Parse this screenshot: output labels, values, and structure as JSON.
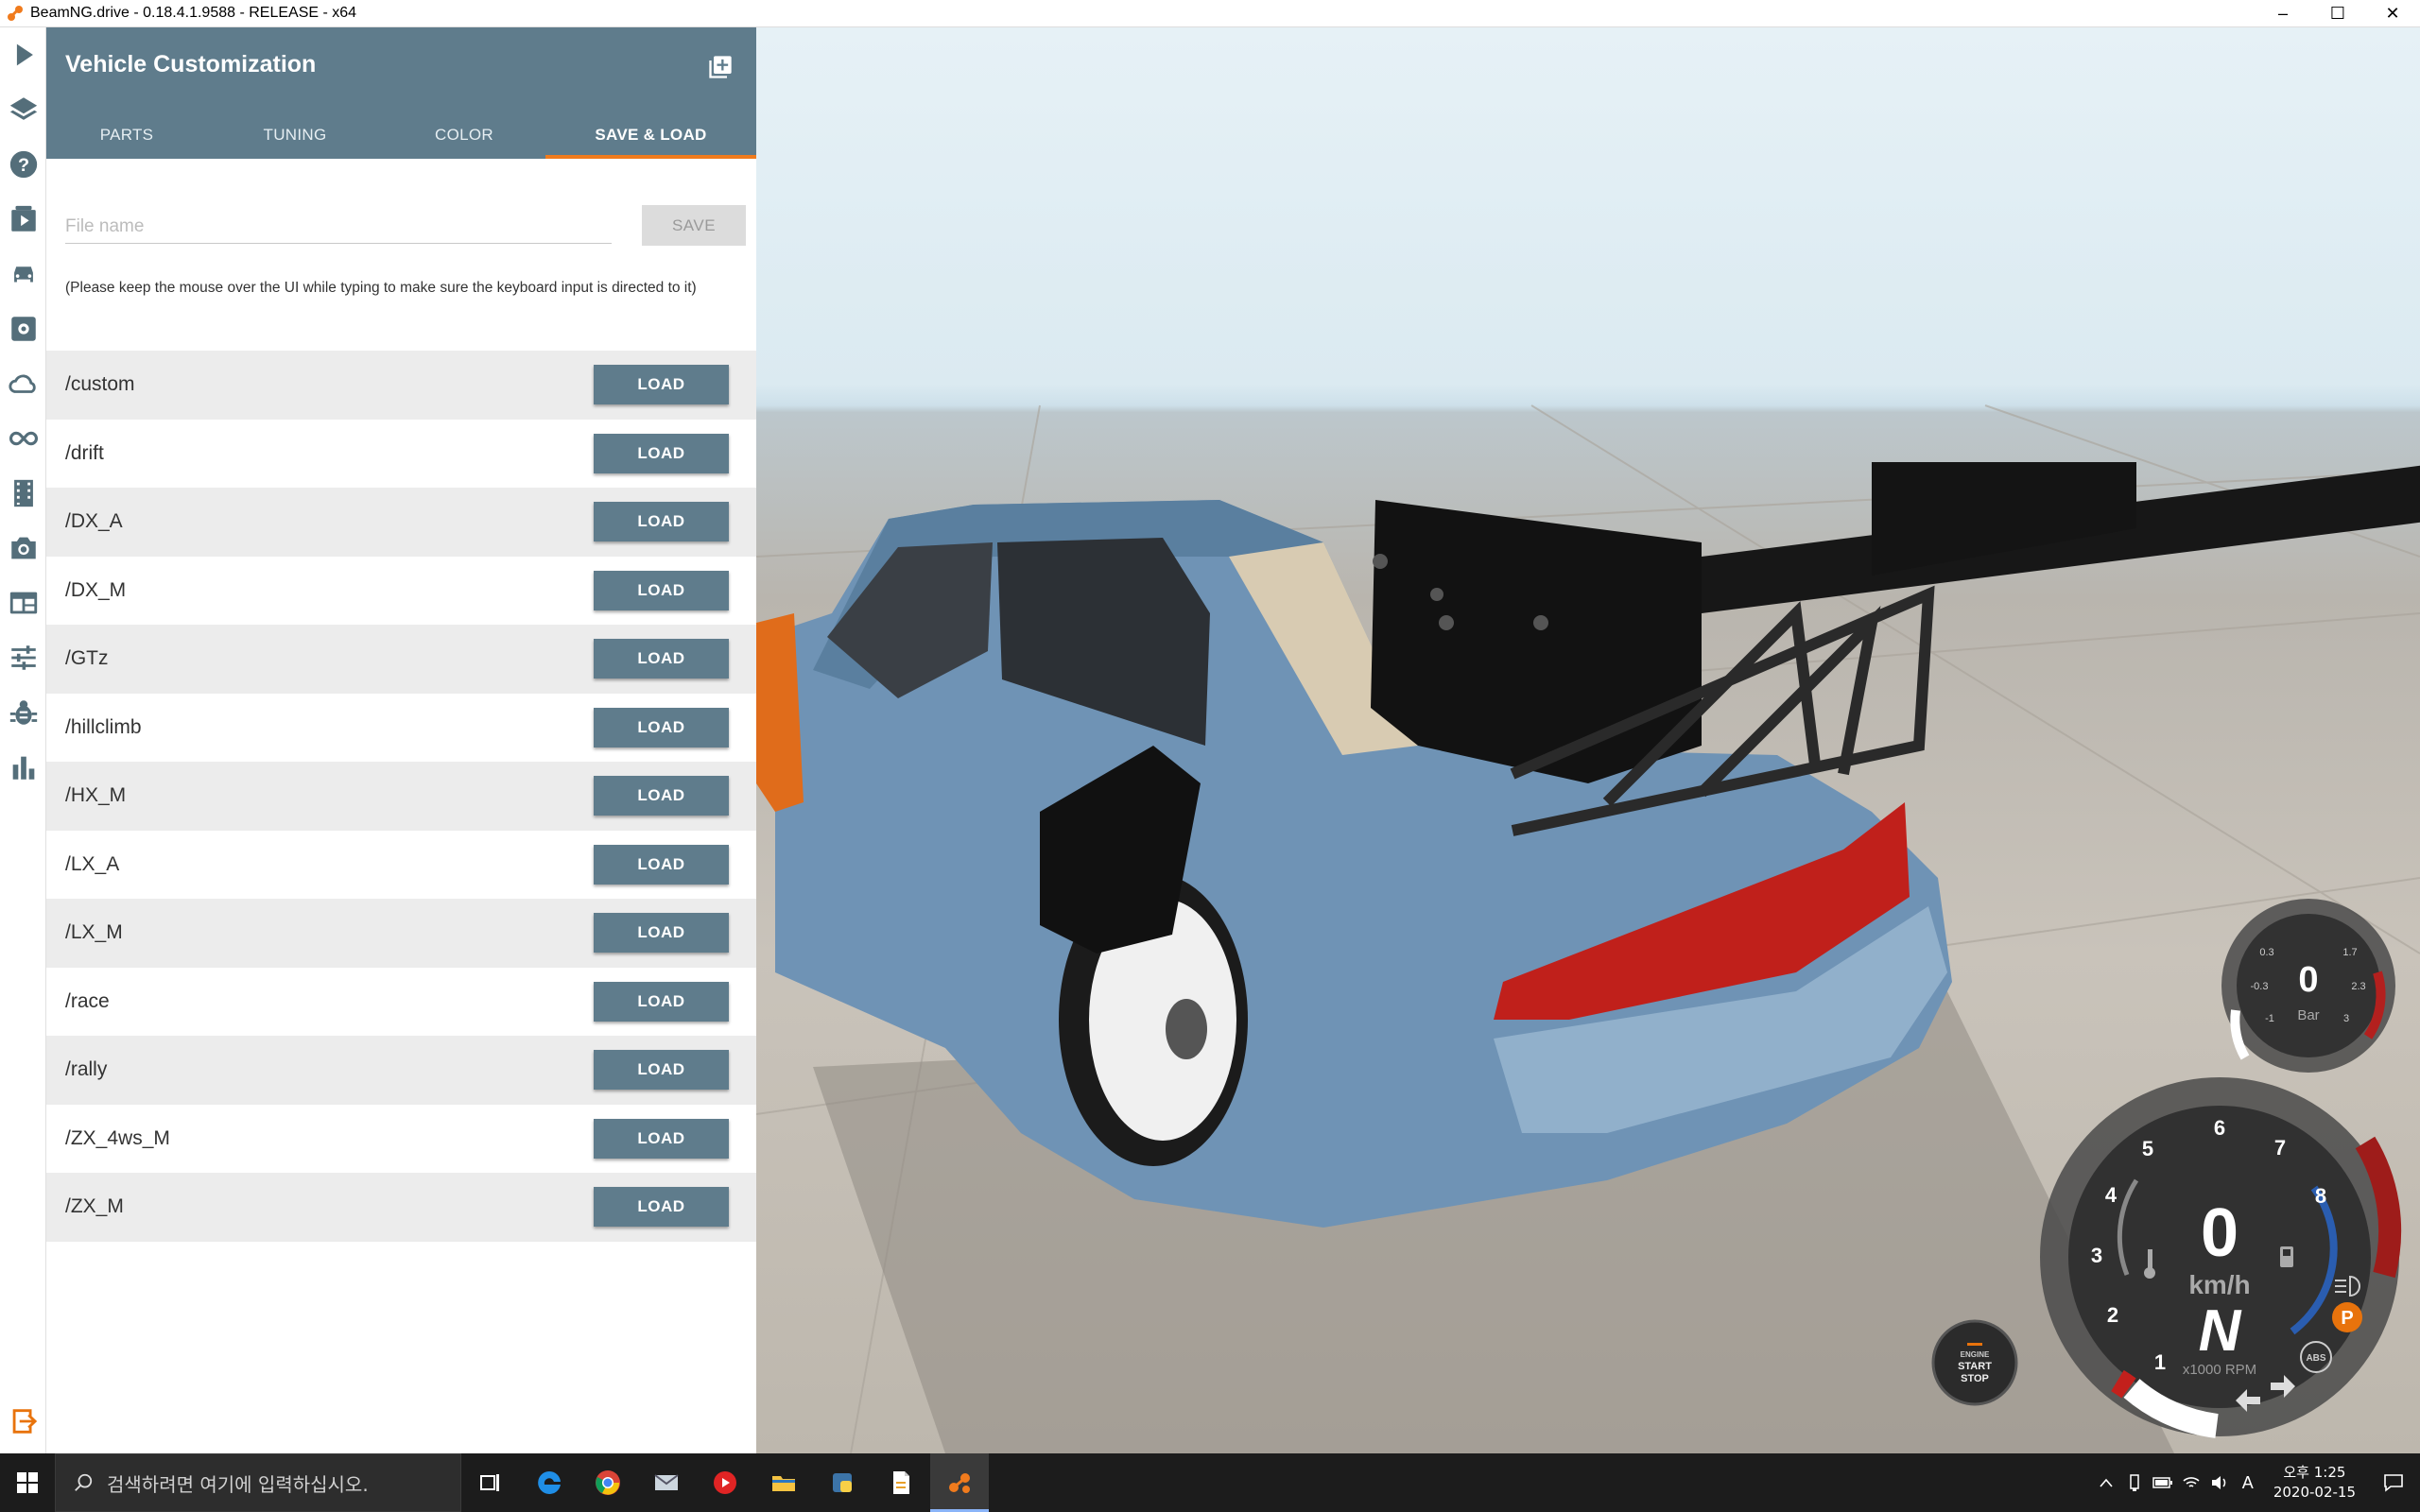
{
  "window": {
    "title": "BeamNG.drive - 0.18.4.1.9588 - RELEASE - x64",
    "minimize": "–",
    "maximize": "☐",
    "close": "✕"
  },
  "toolbar": {
    "items": [
      "play-icon",
      "layers-icon",
      "help-icon",
      "scenario-icon",
      "vehicle-icon",
      "vehicle-config-icon",
      "cloud-icon",
      "infinity-icon",
      "film-icon",
      "camera-icon",
      "apps-icon",
      "sliders-icon",
      "bug-icon",
      "bar-chart-icon",
      "exit-icon"
    ]
  },
  "panel": {
    "title": "Vehicle Customization",
    "tabs": [
      {
        "label": "PARTS"
      },
      {
        "label": "TUNING"
      },
      {
        "label": "COLOR"
      },
      {
        "label": "SAVE & LOAD"
      }
    ],
    "active_tab": "SAVE & LOAD",
    "file_input": {
      "placeholder": "File name",
      "value": ""
    },
    "save_label": "SAVE",
    "hint": "(Please keep the mouse over the UI while typing to make sure the keyboard input is directed to it)",
    "load_label": "LOAD",
    "configs": [
      {
        "name": "/custom"
      },
      {
        "name": "/drift"
      },
      {
        "name": "/DX_A"
      },
      {
        "name": "/DX_M"
      },
      {
        "name": "/GTz"
      },
      {
        "name": "/hillclimb"
      },
      {
        "name": "/HX_M"
      },
      {
        "name": "/LX_A"
      },
      {
        "name": "/LX_M"
      },
      {
        "name": "/race"
      },
      {
        "name": "/rally"
      },
      {
        "name": "/ZX_4ws_M"
      },
      {
        "name": "/ZX_M"
      }
    ]
  },
  "hud": {
    "turbo": {
      "value": "0",
      "unit": "Bar",
      "ticks": [
        "0.3",
        "1.7",
        "-0.3",
        "2.3",
        "-1",
        "3"
      ]
    },
    "speed": {
      "value": "0",
      "unit": "km/h"
    },
    "gear": "N",
    "rpm_label": "x1000 RPM",
    "rpm_ticks": [
      "1",
      "2",
      "3",
      "4",
      "5",
      "6",
      "7",
      "8"
    ],
    "engine_button": {
      "line1": "ENGINE",
      "line2": "START",
      "line3": "STOP"
    },
    "parking": "P",
    "abs": "ABS"
  },
  "taskbar": {
    "search_placeholder": "검색하려면 여기에 입력하십시오.",
    "apps": [
      "task-view-icon",
      "edge-icon",
      "chrome-icon",
      "mail-icon",
      "youtube-icon",
      "file-explorer-icon",
      "python-icon",
      "document-icon",
      "beamng-icon"
    ],
    "ime": "A",
    "time": "오후 1:25",
    "date": "2020-02-15"
  }
}
